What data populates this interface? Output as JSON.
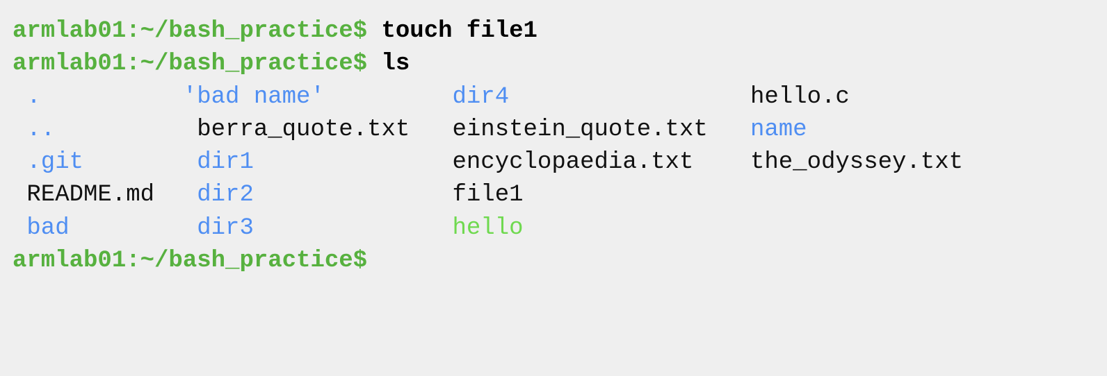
{
  "prompt": "armlab01:~/bash_practice$",
  "commands": [
    "touch file1",
    "ls"
  ],
  "ls_output": {
    "col1": [
      ".",
      "..",
      ".git",
      "README.md",
      "bad"
    ],
    "col2": [
      "'bad name'",
      "berra_quote.txt",
      "dir1",
      "dir2",
      "dir3"
    ],
    "col3": [
      "dir4",
      "einstein_quote.txt",
      "encyclopaedia.txt",
      "file1",
      "hello"
    ],
    "col4": [
      "hello.c",
      "name",
      "the_odyssey.txt"
    ]
  },
  "colors": {
    "prompt": "#57b13f",
    "directory": "#4f8ef2",
    "executable": "#6fd94f",
    "file": "#111111",
    "background": "#efefef"
  }
}
